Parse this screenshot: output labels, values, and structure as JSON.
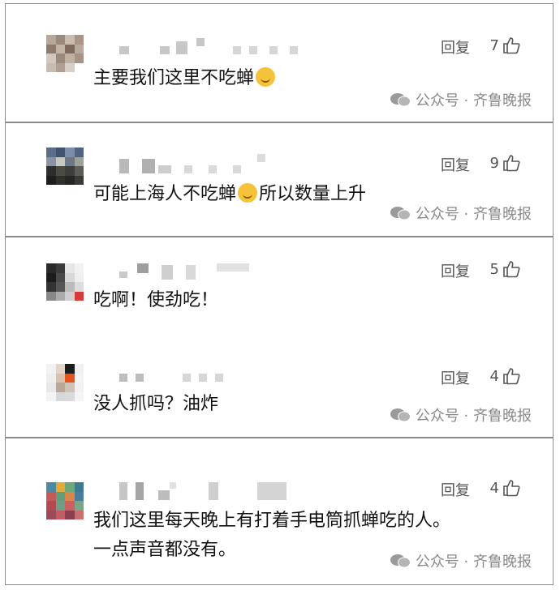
{
  "comments": [
    {
      "text": "主要我们这里不吃蝉",
      "reply": "回复",
      "likes": "7",
      "emoji": "smiling-face-hand-emoji"
    },
    {
      "text_a": "可能上海人不吃蝉",
      "text_b": "所以数量上升",
      "reply": "回复",
      "likes": "9",
      "emoji": "crying-laughing-emoji"
    },
    {
      "text": "吃啊！使劲吃！",
      "reply": "回复",
      "likes": "5"
    },
    {
      "text": "没人抓吗？油炸",
      "reply": "回复",
      "likes": "4"
    },
    {
      "text_line1": "我们这里每天晚上有打着手电筒抓蝉吃的人。",
      "text_line2": "一点声音都没有。",
      "reply": "回复",
      "likes": "4"
    }
  ],
  "watermark": {
    "text": "公众号 · 齐鲁晚报",
    "icon": "wechat-icon"
  },
  "colors": {
    "border": "#8a8a8a",
    "meta": "#555555",
    "watermark": "#8a8a8a",
    "blur": "#c7c7c7"
  }
}
